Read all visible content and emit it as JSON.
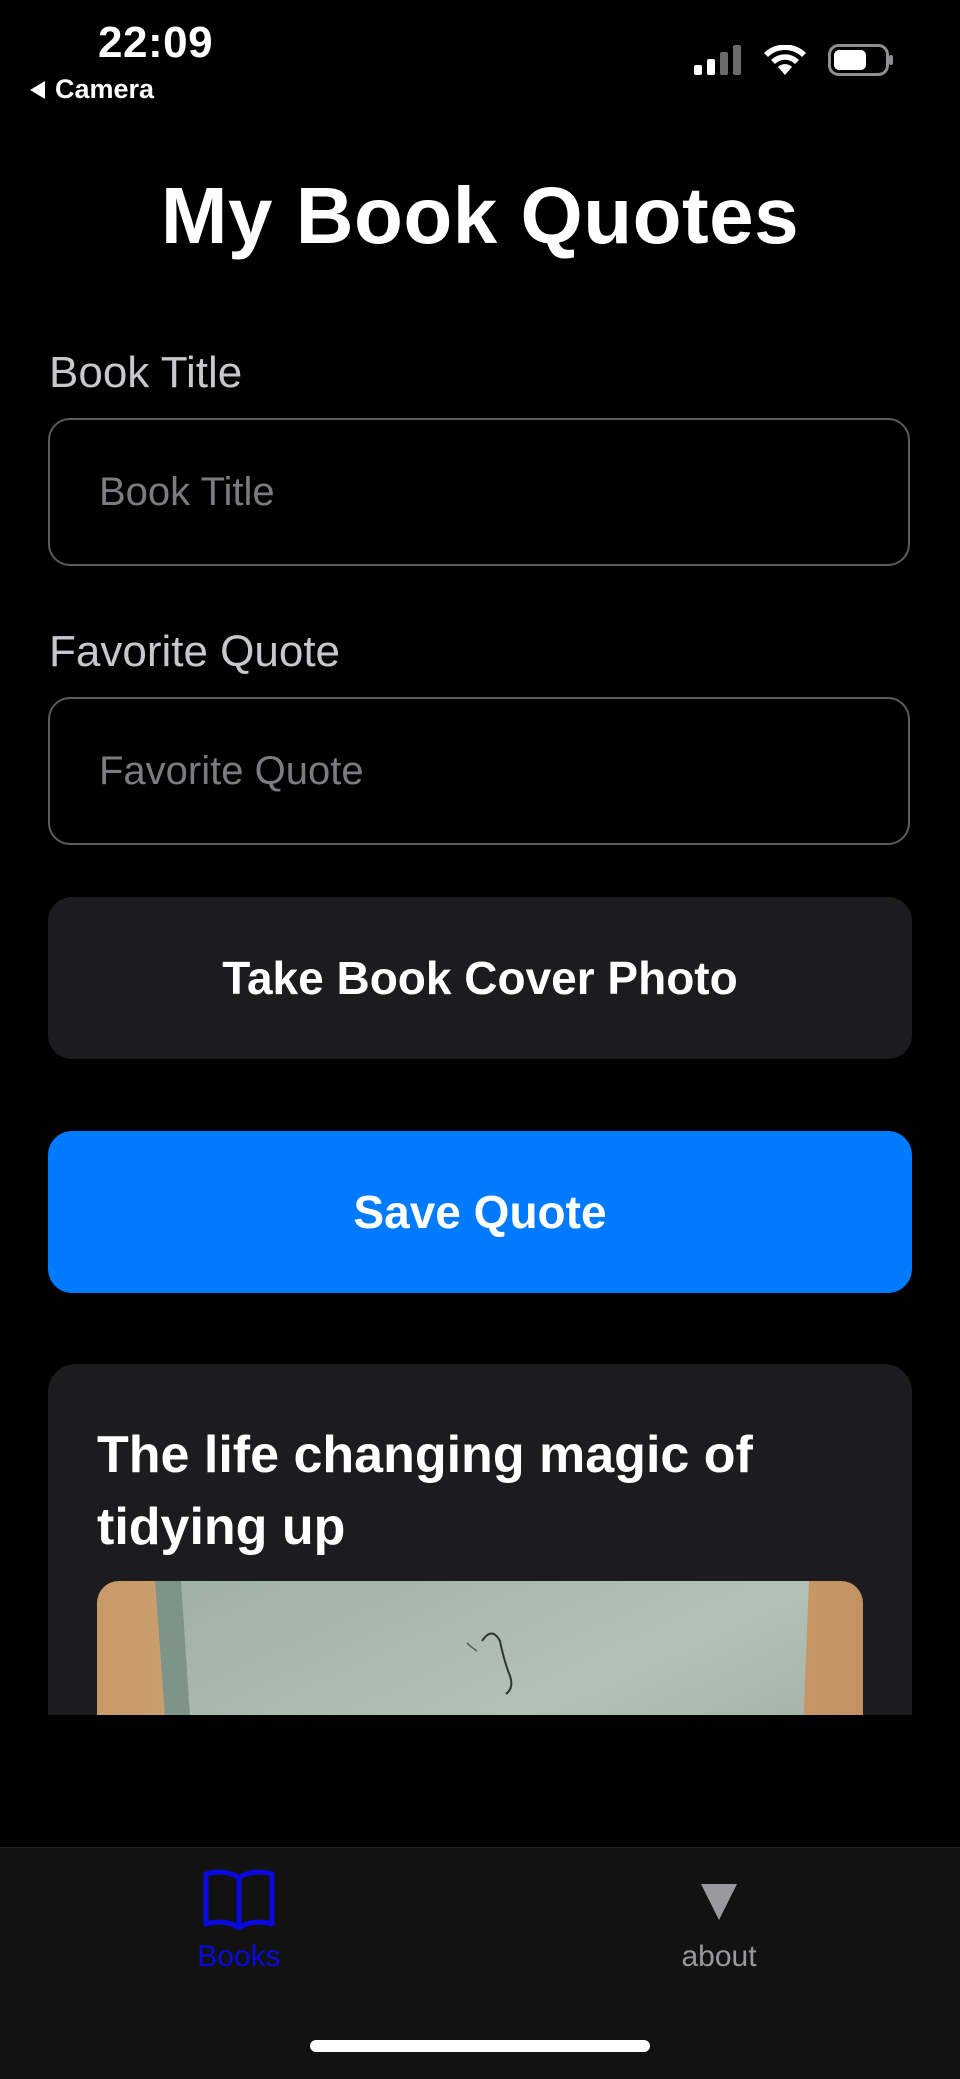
{
  "status_bar": {
    "time": "22:09",
    "back_label": "Camera",
    "icons": [
      "signal-icon",
      "wifi-icon",
      "battery-icon"
    ]
  },
  "page": {
    "title": "My Book Quotes"
  },
  "form": {
    "book_title_label": "Book Title",
    "book_title_placeholder": "Book Title",
    "book_title_value": "",
    "quote_label": "Favorite Quote",
    "quote_placeholder": "Favorite Quote",
    "quote_value": "",
    "photo_button_label": "Take Book Cover Photo",
    "save_button_label": "Save Quote"
  },
  "quotes": [
    {
      "book_title": "The life changing magic of tidying up"
    }
  ],
  "tabbar": {
    "tabs": [
      {
        "label": "Books",
        "icon": "book-icon",
        "active": true
      },
      {
        "label": "about",
        "icon": "triangle-down-icon",
        "active": false
      }
    ]
  },
  "colors": {
    "accent": "#007aff",
    "active_tab": "#0a0adf",
    "card_bg": "#1c1c1e"
  }
}
